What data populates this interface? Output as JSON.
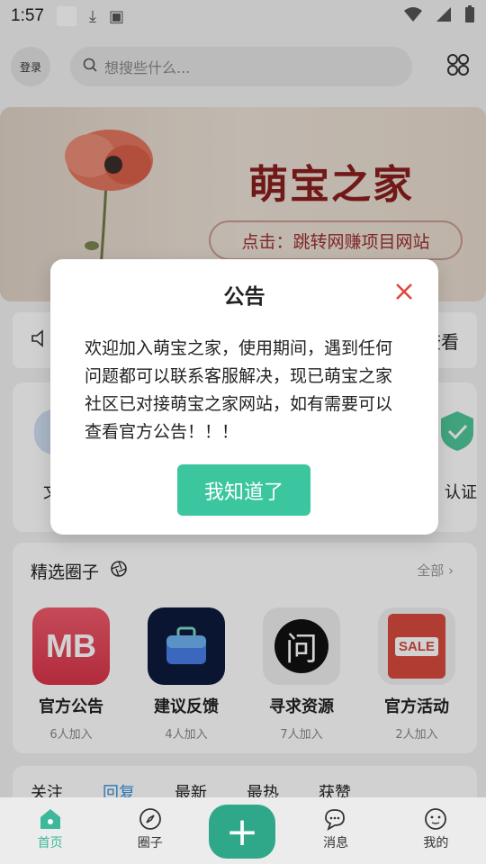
{
  "status_bar": {
    "time": "1:57"
  },
  "header": {
    "login_label": "登录",
    "search_placeholder": "想搜些什么..."
  },
  "banner": {
    "title": "萌宝之家",
    "link_text": "点击：跳转网赚项目网站"
  },
  "notice": {
    "tail_text": "查看"
  },
  "quick": {
    "left_label": "文",
    "right_label": "认证"
  },
  "circles": {
    "title": "精选圈子",
    "all_label": "全部",
    "items": [
      {
        "name": "官方公告",
        "count": "6人加入",
        "icon_text": "MB"
      },
      {
        "name": "建议反馈",
        "count": "4人加入",
        "icon_text": ""
      },
      {
        "name": "寻求资源",
        "count": "7人加入",
        "icon_text": "问"
      },
      {
        "name": "官方活动",
        "count": "2人加入",
        "icon_text": "SALE"
      }
    ]
  },
  "feed_tabs": [
    "关注",
    "回复",
    "最新",
    "最热",
    "获赞"
  ],
  "bottom_nav": [
    {
      "label": "首页"
    },
    {
      "label": "圈子"
    },
    {
      "label": "消息"
    },
    {
      "label": "我的"
    }
  ],
  "dialog": {
    "title": "公告",
    "body": "欢迎加入萌宝之家，使用期间，遇到任何问题都可以联系客服解决，现已萌宝之家社区已对接萌宝之家网站，如有需要可以查看官方公告！！！",
    "button": "我知道了"
  },
  "colors": {
    "accent": "#3cc69f",
    "close": "#e0463c",
    "tab_active": "#3a92d8",
    "fab": "#2fa88a"
  }
}
